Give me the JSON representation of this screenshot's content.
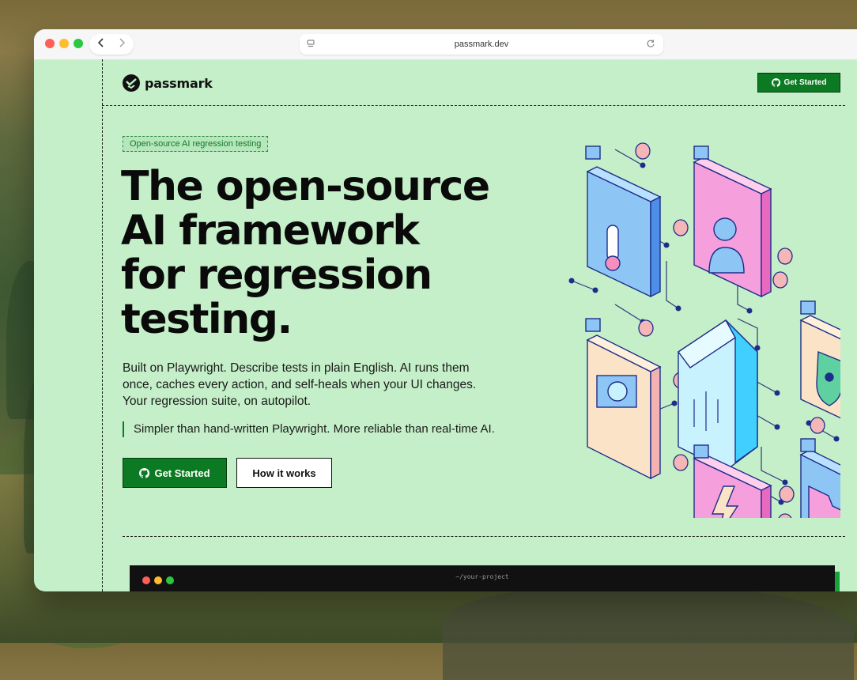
{
  "browser": {
    "url": "passmark.dev",
    "back_icon": "chevron-left-icon",
    "forward_icon": "chevron-right-icon",
    "reload_icon": "reload-icon"
  },
  "nav": {
    "brand": "passmark",
    "cta_label": "Get Started"
  },
  "hero": {
    "badge": "Open-source AI regression testing",
    "headline_lines": [
      "The open-source",
      "AI framework",
      "for regression",
      "testing."
    ],
    "description": "Built on Playwright. Describe tests in plain English. AI runs them once, caches every action, and self-heals when your UI changes. Your regression suite, on autopilot.",
    "quote": "Simpler than hand-written Playwright. More reliable than real-time AI.",
    "primary_label": "Get Started",
    "secondary_label": "How it works"
  },
  "terminal": {
    "title": "~/your-project"
  },
  "colors": {
    "page_bg": "#c4efc8",
    "accent": "#0b7a22",
    "ink": "#0a0a0a"
  }
}
